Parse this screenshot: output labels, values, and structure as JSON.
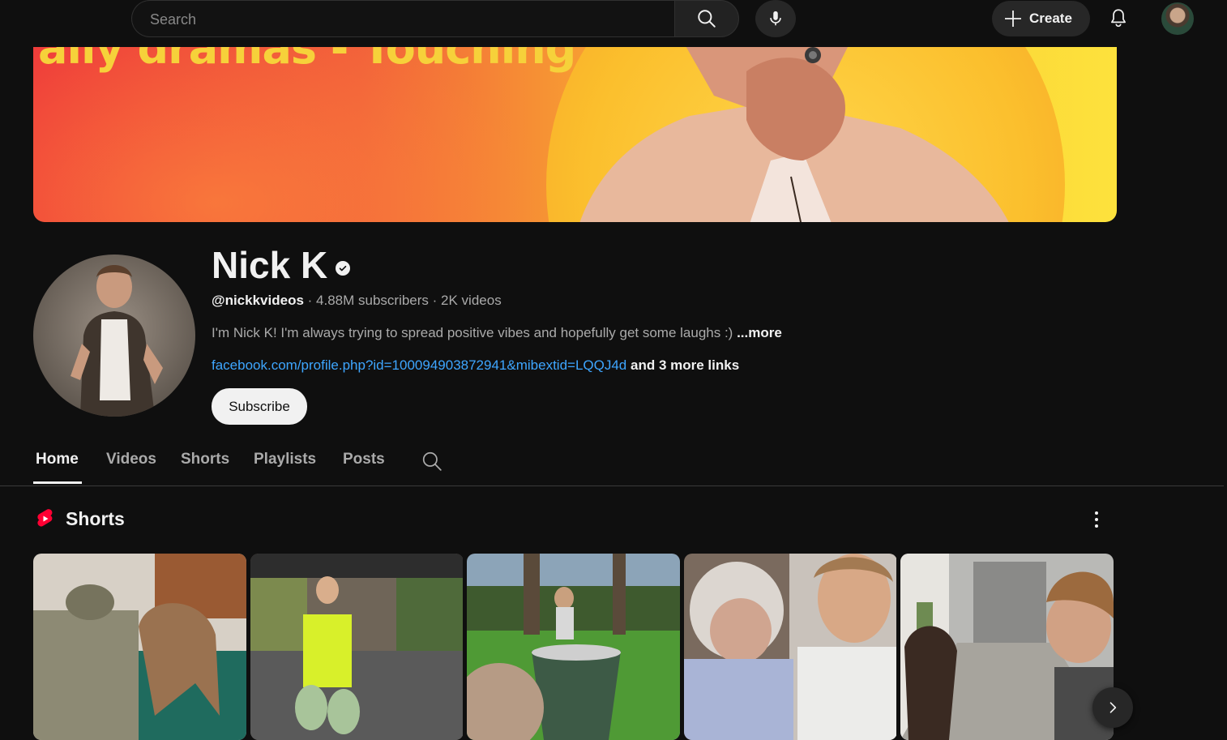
{
  "topbar": {
    "search_placeholder": "Search",
    "create_label": "Create"
  },
  "banner": {
    "text": "ally dramas - Touching stories"
  },
  "channel": {
    "name": "Nick K",
    "handle": "@nickkvideos",
    "subscribers": "· 4.88M subscribers",
    "videos": "· 2K videos",
    "description": "I'm Nick K! I'm always trying to spread positive vibes and hopefully get some laughs :)",
    "more_label": "...more",
    "link": "facebook.com/profile.php?id=100094903872941&mibextid=LQQJ4d",
    "more_links": "and 3 more links",
    "subscribe_label": "Subscribe"
  },
  "tabs": [
    {
      "label": "Home",
      "active": true
    },
    {
      "label": "Videos",
      "active": false
    },
    {
      "label": "Shorts",
      "active": false
    },
    {
      "label": "Playlists",
      "active": false
    },
    {
      "label": "Posts",
      "active": false
    }
  ],
  "shorts_section": {
    "title": "Shorts"
  },
  "colors": {
    "background": "#0f0f0f",
    "link": "#3ea6ff",
    "shorts_red": "#ff0033"
  }
}
